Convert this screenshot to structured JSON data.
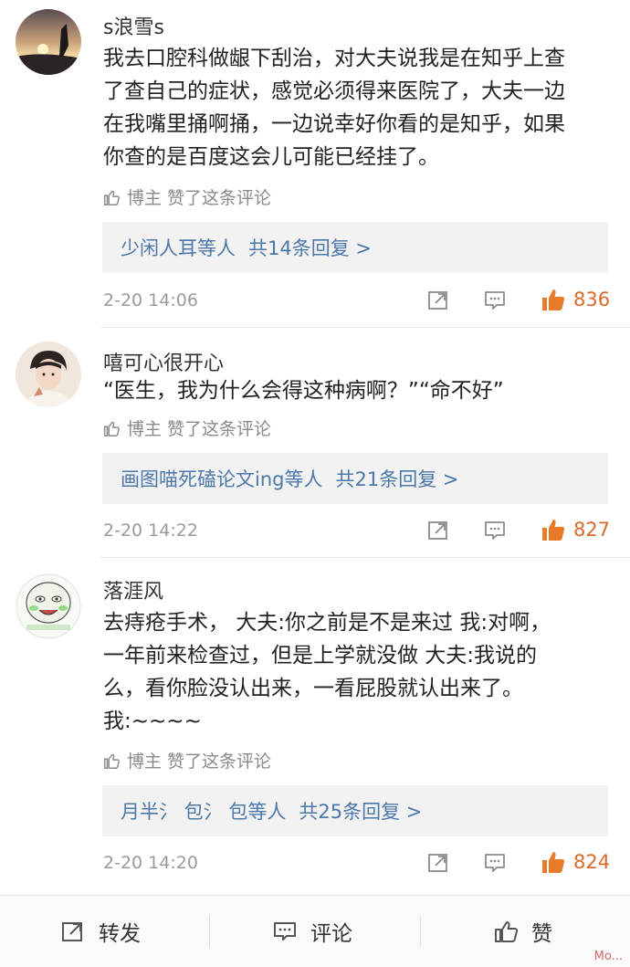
{
  "comments": [
    {
      "username": "s浪雪s",
      "lines": [
        "我去口腔科做龈下刮治，对大夫说我是在知乎上查",
        "了查自己的症状，感觉必须得来医院了，大夫一边",
        "在我嘴里捅啊捅，一边说幸好你看的是知乎，如果",
        "你查的是百度这会儿可能已经挂了。"
      ],
      "liked_by_author": "博主 赞了这条评论",
      "reply_users": "少闲人耳等人",
      "reply_count": "共14条回复 >",
      "date": "2-20 14:06",
      "likes": "836"
    },
    {
      "username": "嘻可心很开心",
      "lines": [
        "“医生，我为什么会得这种病啊？”“命不好”"
      ],
      "liked_by_author": "博主 赞了这条评论",
      "reply_users": "画图喵死磕论文ing等人",
      "reply_count": "共21条回复 >",
      "date": "2-20 14:22",
      "likes": "827"
    },
    {
      "username": "落涯风",
      "lines": [
        "去痔疮手术， 大夫:你之前是不是来过 我:对啊，",
        "一年前来检查过，但是上学就没做 大夫:我说的",
        "么，看你脸没认出来，一看屁股就认出来了。",
        "我:~~~~"
      ],
      "liked_by_author": "博主 赞了这条评论",
      "reply_users": "月半氵 包氵 包等人",
      "reply_count": "共25条回复 >",
      "date": "2-20 14:20",
      "likes": "824"
    }
  ],
  "bottom_bar": {
    "repost": "转发",
    "comment": "评论",
    "like": "赞"
  },
  "watermark": "Mo...",
  "colors": {
    "link": "#4c78ab",
    "like_accent": "#d86a2b",
    "muted": "#8a8a8a"
  }
}
